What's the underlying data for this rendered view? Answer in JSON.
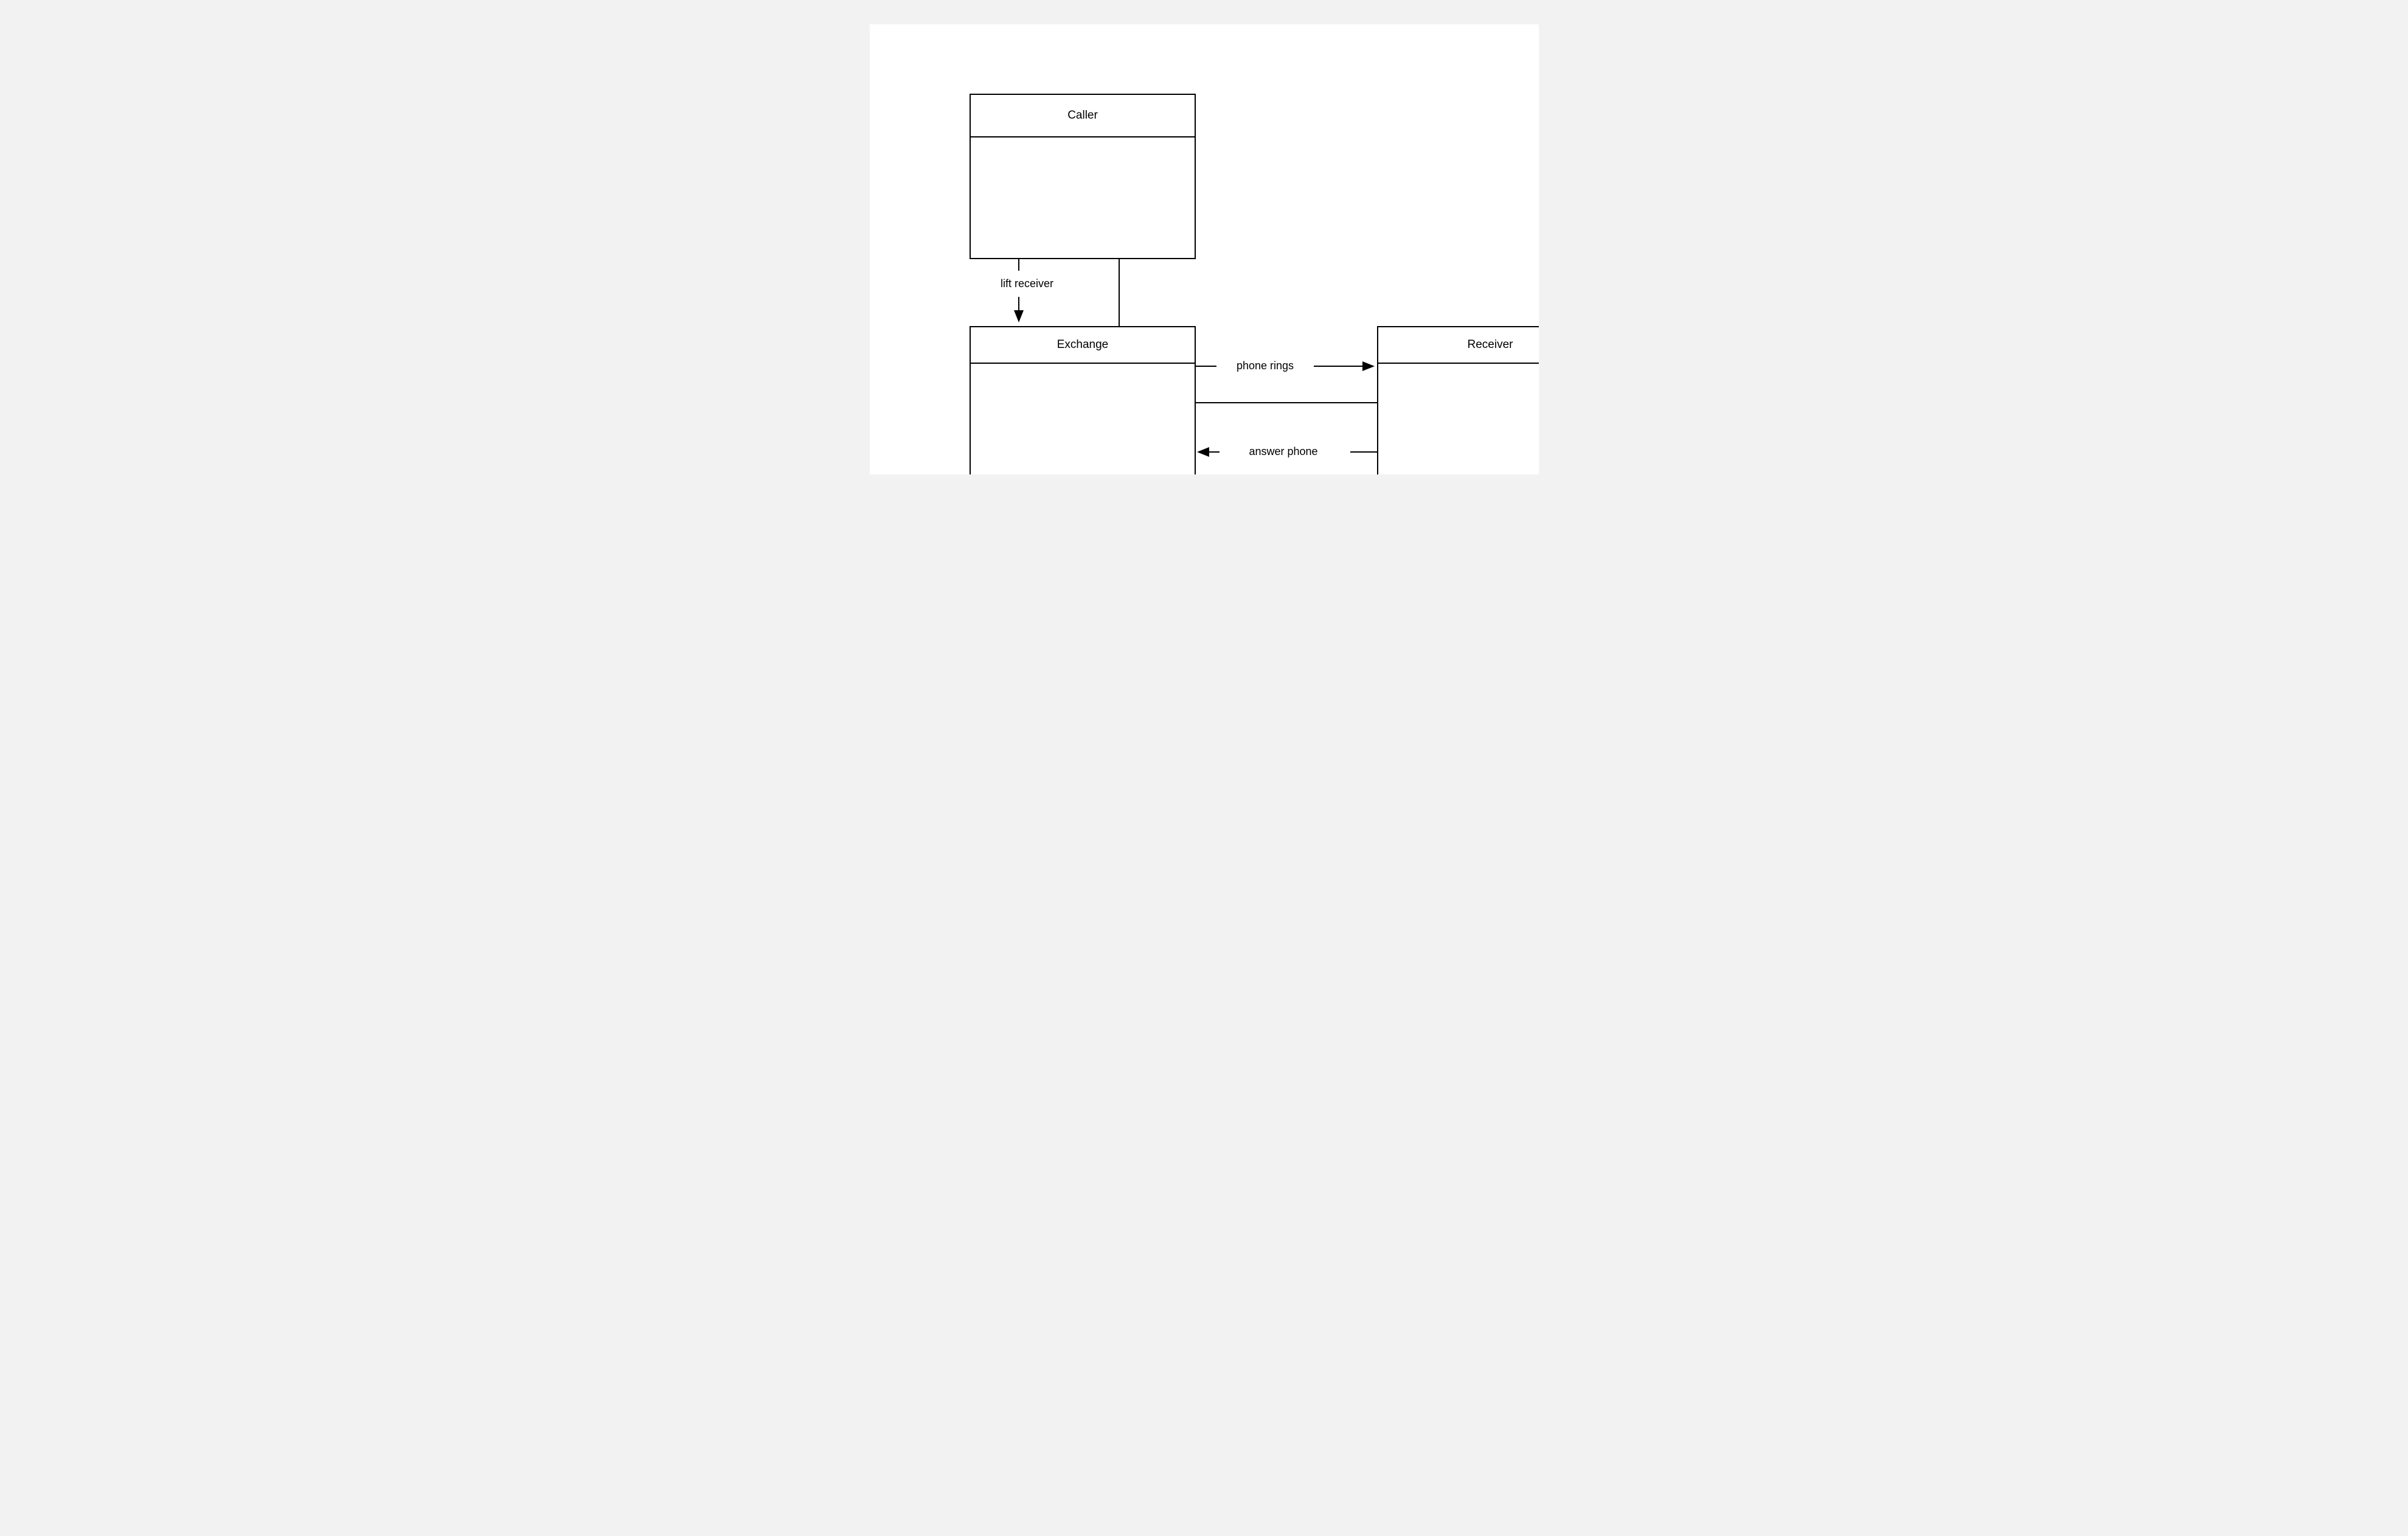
{
  "diagram": {
    "nodes": {
      "caller": {
        "title": "Caller"
      },
      "exchange": {
        "title": "Exchange"
      },
      "receiver": {
        "title": "Receiver"
      }
    },
    "edges": {
      "lift_receiver": {
        "label": "lift receiver"
      },
      "phone_rings": {
        "label": "phone rings"
      },
      "answer_phone": {
        "label": "answer phone"
      }
    }
  }
}
